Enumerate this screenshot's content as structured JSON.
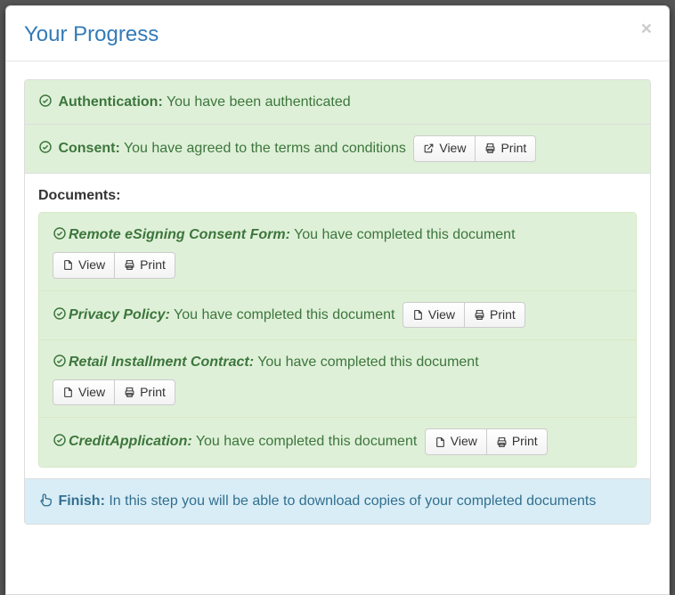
{
  "header": {
    "title": "Your Progress",
    "close": "×"
  },
  "auth": {
    "label": "Authentication:",
    "text": "You have been authenticated"
  },
  "consent": {
    "label": "Consent:",
    "text": "You have agreed to the terms and conditions",
    "view": "View",
    "print": "Print"
  },
  "documents": {
    "label": "Documents:",
    "view": "View",
    "print": "Print",
    "items": [
      {
        "title": "Remote eSigning Consent Form",
        "text": "You have completed this document",
        "inlineButtons": false
      },
      {
        "title": "Privacy Policy",
        "text": "You have completed this document",
        "inlineButtons": true
      },
      {
        "title": "Retail Installment Contract",
        "text": "You have completed this document",
        "inlineButtons": false
      },
      {
        "title": "CreditApplication",
        "text": "You have completed this document",
        "inlineButtons": true
      }
    ]
  },
  "finish": {
    "label": "Finish:",
    "text": "In this step you will be able to download copies of your completed documents"
  }
}
